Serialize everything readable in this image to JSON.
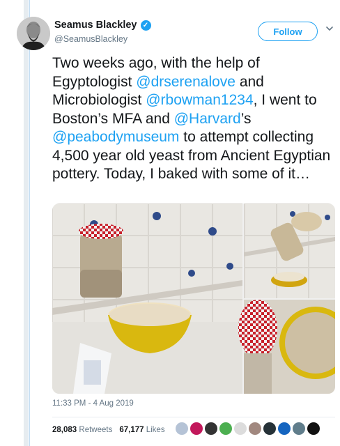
{
  "author": {
    "name": "Seamus Blackley",
    "handle": "@SeamusBlackley",
    "verified": true
  },
  "follow_label": "Follow",
  "tweet": {
    "segments": [
      {
        "text": "Two weeks ago, with the help of Egyptologist ",
        "mention": false
      },
      {
        "text": "@drserenalove",
        "mention": true
      },
      {
        "text": " and Microbiologist ",
        "mention": false
      },
      {
        "text": "@rbowman1234",
        "mention": true
      },
      {
        "text": ", I went to Boston’s MFA and ",
        "mention": false
      },
      {
        "text": "@Harvard",
        "mention": true
      },
      {
        "text": "’s ",
        "mention": false
      },
      {
        "text": "@peabodymuseum",
        "mention": true
      },
      {
        "text": " to attempt collecting 4,500 year old yeast from Ancient Egyptian pottery. Today, I baked with some of it…",
        "mention": false
      }
    ]
  },
  "timestamp": "11:33 PM - 4 Aug 2019",
  "stats": {
    "retweets_count": "28,083",
    "retweets_label": "Retweets",
    "likes_count": "67,177",
    "likes_label": "Likes"
  },
  "colors": {
    "link": "#1da1f2",
    "text": "#14171a",
    "muted": "#657786"
  },
  "icons": [
    "verified-badge-icon",
    "chevron-down-icon"
  ]
}
